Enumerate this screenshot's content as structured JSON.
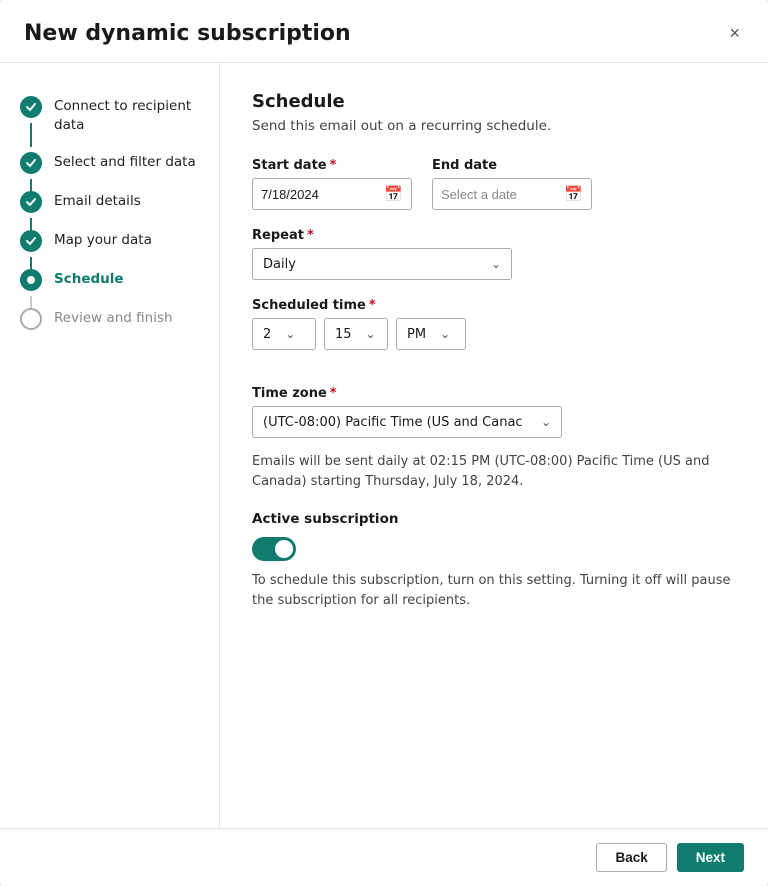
{
  "modal": {
    "title": "New dynamic subscription",
    "close_label": "×"
  },
  "sidebar": {
    "steps": [
      {
        "id": "connect",
        "label": "Connect to recipient data",
        "state": "done"
      },
      {
        "id": "filter",
        "label": "Select and filter data",
        "state": "done"
      },
      {
        "id": "email",
        "label": "Email details",
        "state": "done"
      },
      {
        "id": "map",
        "label": "Map your data",
        "state": "done"
      },
      {
        "id": "schedule",
        "label": "Schedule",
        "state": "active"
      },
      {
        "id": "review",
        "label": "Review and finish",
        "state": "inactive"
      }
    ]
  },
  "main": {
    "section_title": "Schedule",
    "section_desc": "Send this email out on a recurring schedule.",
    "start_date_label": "Start date",
    "start_date_required": true,
    "start_date_value": "7/18/2024",
    "end_date_label": "End date",
    "end_date_placeholder": "Select a date",
    "repeat_label": "Repeat",
    "repeat_required": true,
    "repeat_value": "Daily",
    "scheduled_time_label": "Scheduled time",
    "scheduled_time_required": true,
    "time_hour": "2",
    "time_minute": "15",
    "time_ampm": "PM",
    "timezone_label": "Time zone",
    "timezone_required": true,
    "timezone_value": "(UTC-08:00) Pacific Time (US and Canac",
    "info_text": "Emails will be sent daily at 02:15 PM (UTC-08:00) Pacific Time (US and Canada) starting Thursday, July 18, 2024.",
    "active_sub_label": "Active subscription",
    "toggle_hint": "To schedule this subscription, turn on this setting. Turning it off will pause the subscription for all recipients."
  },
  "footer": {
    "back_label": "Back",
    "next_label": "Next"
  },
  "colors": {
    "brand": "#107c6e",
    "required": "#c50f1f"
  }
}
